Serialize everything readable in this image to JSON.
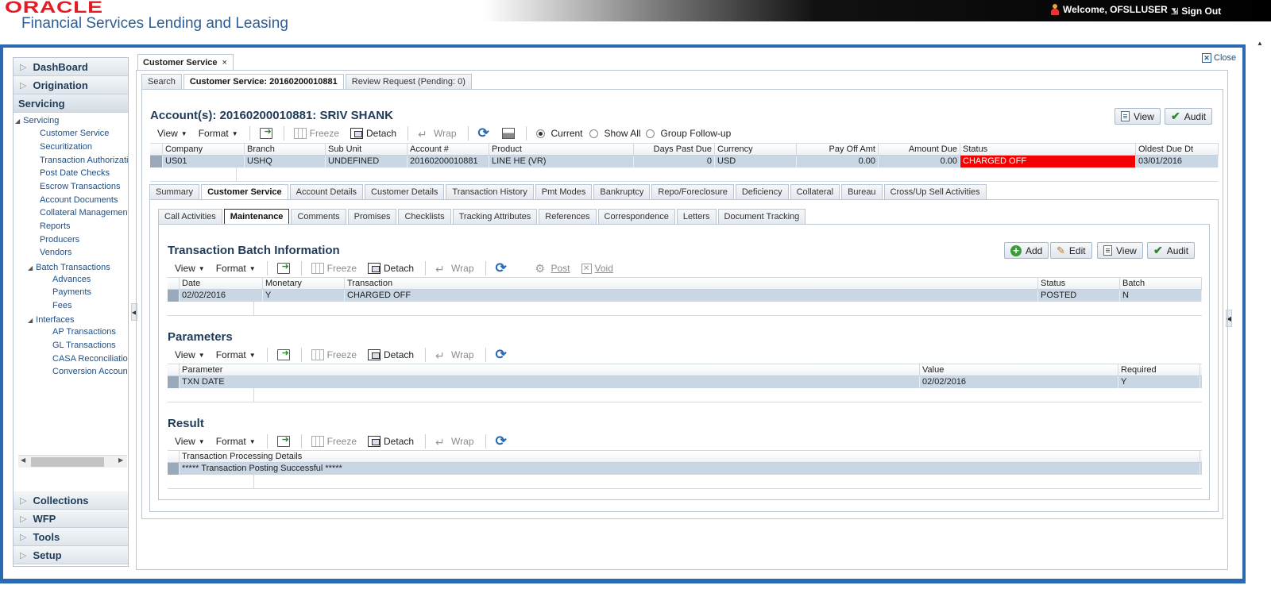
{
  "header": {
    "logo": "ORACLE",
    "app_title": "Financial Services Lending and Leasing",
    "welcome": "Welcome, OFSLLUSER",
    "sign_out": "Sign Out"
  },
  "sidebar": {
    "sections_top": [
      "DashBoard",
      "Origination"
    ],
    "open_section": "Servicing",
    "tree": {
      "root": "Servicing",
      "items": [
        "Customer Service",
        "Securitization",
        "Transaction Authorizati",
        "Post Date Checks",
        "Escrow Transactions",
        "Account Documents",
        "Collateral Management",
        "Reports",
        "Producers",
        "Vendors"
      ],
      "batch": "Batch Transactions",
      "batch_items": [
        "Advances",
        "Payments",
        "Fees"
      ],
      "interfaces": "Interfaces",
      "interface_items": [
        "AP Transactions",
        "GL Transactions",
        "CASA Reconciliation",
        "Conversion Account"
      ]
    },
    "sections_bottom": [
      "Collections",
      "WFP",
      "Tools",
      "Setup"
    ]
  },
  "outer_tab": {
    "label": "Customer Service",
    "close": "×"
  },
  "close_label": "Close",
  "top_tabs": [
    "Search",
    "Customer Service: 20160200010881",
    "Review Request (Pending: 0)"
  ],
  "account": {
    "title": "Account(s): 20160200010881: SRIV SHANK",
    "view_label": "View",
    "audit_label": "Audit",
    "radios": [
      "Current",
      "Show All",
      "Group Follow-up"
    ],
    "columns": [
      "Company",
      "Branch",
      "Sub Unit",
      "Account #",
      "Product",
      "Days Past Due",
      "Currency",
      "Pay Off Amt",
      "Amount Due",
      "Status",
      "Oldest Due Dt"
    ],
    "row": [
      "US01",
      "USHQ",
      "UNDEFINED",
      "20160200010881",
      "LINE HE (VR)",
      "0",
      "USD",
      "0.00",
      "0.00",
      "CHARGED OFF",
      "03/01/2016"
    ]
  },
  "toolbar": {
    "view": "View",
    "format": "Format",
    "freeze": "Freeze",
    "detach": "Detach",
    "wrap": "Wrap",
    "post": "Post",
    "void": "Void"
  },
  "account_tabs": [
    "Summary",
    "Customer Service",
    "Account Details",
    "Customer Details",
    "Transaction History",
    "Pmt Modes",
    "Bankruptcy",
    "Repo/Foreclosure",
    "Deficiency",
    "Collateral",
    "Bureau",
    "Cross/Up Sell Activities"
  ],
  "cs_tabs": [
    "Call Activities",
    "Maintenance",
    "Comments",
    "Promises",
    "Checklists",
    "Tracking Attributes",
    "References",
    "Correspondence",
    "Letters",
    "Document Tracking"
  ],
  "batch": {
    "title": "Transaction Batch Information",
    "add": "Add",
    "edit": "Edit",
    "view": "View",
    "audit": "Audit",
    "columns": [
      "Date",
      "Monetary",
      "Transaction",
      "Status",
      "Batch"
    ],
    "row": [
      "02/02/2016",
      "Y",
      "CHARGED OFF",
      "POSTED",
      "N"
    ]
  },
  "parameters": {
    "title": "Parameters",
    "columns": [
      "Parameter",
      "Value",
      "Required"
    ],
    "row": [
      "TXN DATE",
      "02/02/2016",
      "Y"
    ]
  },
  "result": {
    "title": "Result",
    "column": "Transaction Processing Details",
    "row": "***** Transaction Posting Successful *****"
  },
  "colors": {
    "brand_red": "#e31b23",
    "frame_blue": "#2a6ab3",
    "status_red": "#f40000",
    "row_blue": "#c9d6e3"
  }
}
